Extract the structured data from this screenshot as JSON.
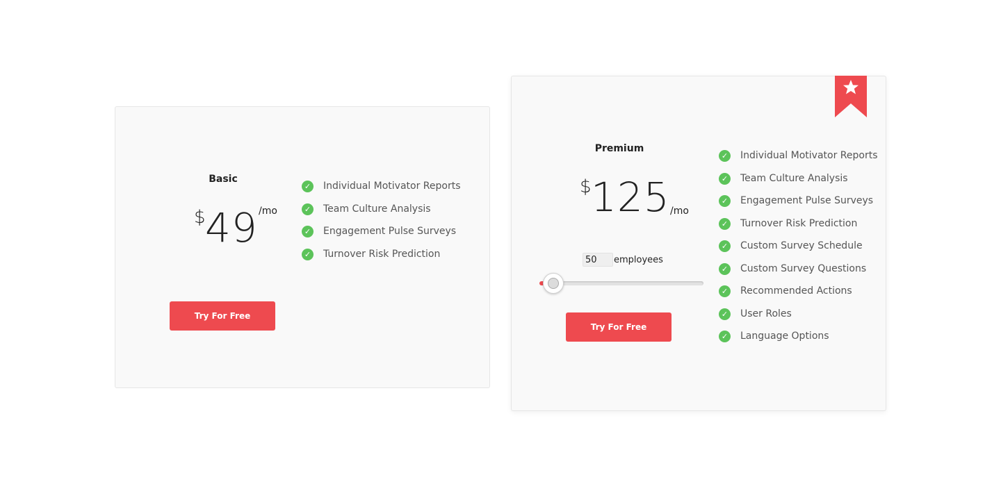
{
  "basic": {
    "name": "Basic",
    "currency": "$",
    "price": "49",
    "period": "/mo",
    "features": [
      "Individual Motivator Reports",
      "Team Culture Analysis",
      "Engagement Pulse Surveys",
      "Turnover Risk Prediction"
    ],
    "cta_label": "Try For Free"
  },
  "premium": {
    "name": "Premium",
    "currency": "$",
    "price": "125",
    "period": "/mo",
    "employees_value": "50",
    "employees_label": "employees",
    "slider_level": 0.0,
    "features": [
      "Individual Motivator Reports",
      "Team Culture Analysis",
      "Engagement Pulse Surveys",
      "Turnover Risk Prediction",
      "Custom Survey Schedule",
      "Custom Survey Questions",
      "Recommended Actions",
      "User Roles",
      "Language Options"
    ],
    "cta_label": "Try For Free",
    "badge_icon": "star-icon"
  },
  "colors": {
    "accent": "#ee4a4f",
    "check": "#5cc35a",
    "card_bg": "#f9f9f9"
  }
}
